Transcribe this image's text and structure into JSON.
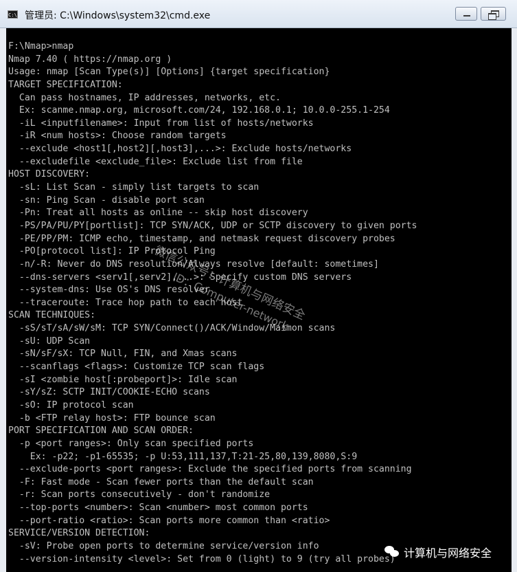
{
  "window": {
    "title": "管理员: C:\\Windows\\system32\\cmd.exe",
    "app_icon": "cmd-icon",
    "app_icon_text": "C:\\"
  },
  "console": {
    "lines": [
      "F:\\Nmap>nmap",
      "Nmap 7.40 ( https://nmap.org )",
      "Usage: nmap [Scan Type(s)] [Options] {target specification}",
      "TARGET SPECIFICATION:",
      "  Can pass hostnames, IP addresses, networks, etc.",
      "  Ex: scanme.nmap.org, microsoft.com/24, 192.168.0.1; 10.0.0-255.1-254",
      "  -iL <inputfilename>: Input from list of hosts/networks",
      "  -iR <num hosts>: Choose random targets",
      "  --exclude <host1[,host2][,host3],...>: Exclude hosts/networks",
      "  --excludefile <exclude_file>: Exclude list from file",
      "HOST DISCOVERY:",
      "  -sL: List Scan - simply list targets to scan",
      "  -sn: Ping Scan - disable port scan",
      "  -Pn: Treat all hosts as online -- skip host discovery",
      "  -PS/PA/PU/PY[portlist]: TCP SYN/ACK, UDP or SCTP discovery to given ports",
      "  -PE/PP/PM: ICMP echo, timestamp, and netmask request discovery probes",
      "  -PO[protocol list]: IP Protocol Ping",
      "  -n/-R: Never do DNS resolution/Always resolve [default: sometimes]",
      "  --dns-servers <serv1[,serv2],...>: Specify custom DNS servers",
      "  --system-dns: Use OS's DNS resolver",
      "  --traceroute: Trace hop path to each host",
      "SCAN TECHNIQUES:",
      "  -sS/sT/sA/sW/sM: TCP SYN/Connect()/ACK/Window/Maimon scans",
      "  -sU: UDP Scan",
      "  -sN/sF/sX: TCP Null, FIN, and Xmas scans",
      "  --scanflags <flags>: Customize TCP scan flags",
      "  -sI <zombie host[:probeport]>: Idle scan",
      "  -sY/sZ: SCTP INIT/COOKIE-ECHO scans",
      "  -sO: IP protocol scan",
      "  -b <FTP relay host>: FTP bounce scan",
      "PORT SPECIFICATION AND SCAN ORDER:",
      "  -p <port ranges>: Only scan specified ports",
      "    Ex: -p22; -p1-65535; -p U:53,111,137,T:21-25,80,139,8080,S:9",
      "  --exclude-ports <port ranges>: Exclude the specified ports from scanning",
      "  -F: Fast mode - Scan fewer ports than the default scan",
      "  -r: Scan ports consecutively - don't randomize",
      "  --top-ports <number>: Scan <number> most common ports",
      "  --port-ratio <ratio>: Scan ports more common than <ratio>",
      "SERVICE/VERSION DETECTION:",
      "  -sV: Probe open ports to determine service/version info",
      "  --version-intensity <level>: Set from 0 (light) to 9 (try all probes)"
    ]
  },
  "watermark": {
    "line1": "微信公众号：计算机与网络安全",
    "line2": "ID：Computer-network"
  },
  "logo": {
    "icon": "wechat-icon",
    "text": "计算机与网络安全"
  }
}
